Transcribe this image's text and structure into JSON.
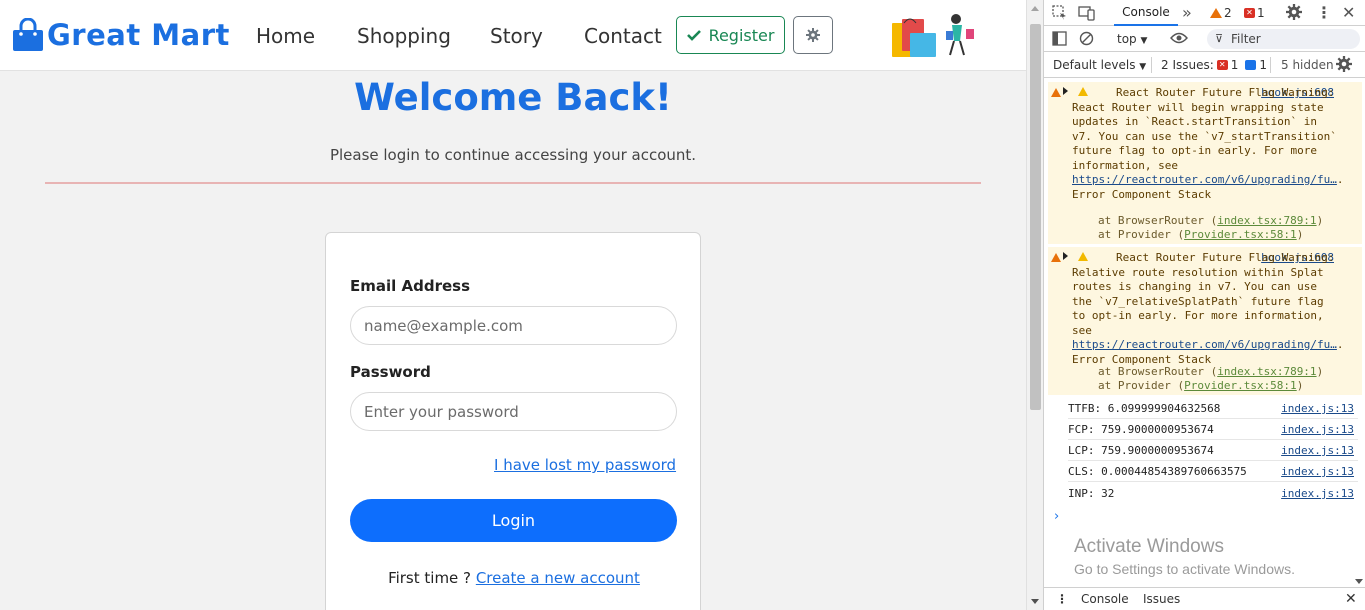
{
  "brand": {
    "name": "Great Mart"
  },
  "nav": {
    "links": [
      "Home",
      "Shopping",
      "Story",
      "Contact"
    ],
    "register_label": "Register"
  },
  "main": {
    "title": "Welcome Back!",
    "subtitle": "Please login to continue accessing your account.",
    "email_label": "Email Address",
    "email_placeholder": "name@example.com",
    "password_label": "Password",
    "password_placeholder": "Enter your password",
    "forgot_label": "I have lost my password",
    "login_label": "Login",
    "first_time_text": "First time ?",
    "create_account_label": "Create a new account"
  },
  "colors": {
    "brand_blue": "#1b6fe0",
    "login_button": "#0d6efd",
    "register_green": "#198754",
    "warning_bg": "#fef7e0"
  },
  "devtools": {
    "tab_console": "Console",
    "more_tabs": "»",
    "warning_count": "2",
    "error_count": "1",
    "context": "top",
    "filter_placeholder": "Filter",
    "levels_label": "Default levels",
    "issues_label": "2 Issues:",
    "issues_errors": "1",
    "issues_info": "1",
    "hidden_label": "5 hidden",
    "messages": [
      {
        "text": "React Router Future Flag Warning: React Router will begin wrapping state updates in `React.startTransition` in v7. You can use the `v7_startTransition` future flag to opt-in early. For more information, see",
        "link": "https://reactrouter.com/v6/upgrading/fu…",
        "suffix": ". Error Component Stack",
        "source": "hook.js:608",
        "stack1_prefix": "at BrowserRouter (",
        "stack1_link": "index.tsx:789:1",
        "stack2_prefix": "at Provider (",
        "stack2_link": "Provider.tsx:58:1"
      },
      {
        "text": "React Router Future Flag Warning: Relative route resolution within Splat routes is changing in v7. You can use the `v7_relativeSplatPath` future flag to opt-in early. For more information, see",
        "link": "https://reactrouter.com/v6/upgrading/fu…",
        "suffix": ". Error Component Stack",
        "source": "hook.js:608",
        "stack1_prefix": "at BrowserRouter (",
        "stack1_link": "index.tsx:789:1",
        "stack2_prefix": "at Provider (",
        "stack2_link": "Provider.tsx:58:1"
      }
    ],
    "logs": [
      {
        "text": "TTFB: 6.099999904632568",
        "source": "index.js:13"
      },
      {
        "text": "FCP: 759.9000000953674",
        "source": "index.js:13"
      },
      {
        "text": "LCP: 759.9000000953674",
        "source": "index.js:13"
      },
      {
        "text": "CLS: 0.00044854389760663575",
        "source": "index.js:13"
      },
      {
        "text": "INP: 32",
        "source": "index.js:13"
      }
    ],
    "prompt": "›",
    "watermark_line1": "Activate Windows",
    "watermark_line2": "Go to Settings to activate Windows.",
    "drawer_console": "Console",
    "drawer_issues": "Issues"
  }
}
